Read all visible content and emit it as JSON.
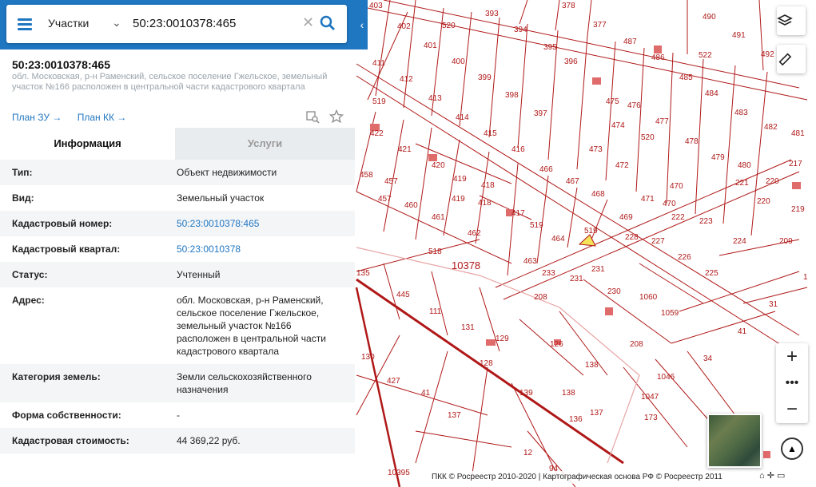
{
  "search": {
    "type_label": "Участки",
    "value": "50:23:0010378:465",
    "clear_symbol": "✕"
  },
  "panel": {
    "title": "50:23:0010378:465",
    "address_sub": "обл. Московская, р-н Раменский, сельское поселение Гжельское, земельный участок №166 расположен в центральной части кадастрового квартала",
    "link_plan_zu": "План ЗУ →",
    "link_plan_kk": "План КК →",
    "tab_info": "Информация",
    "tab_services": "Услуги",
    "rows": [
      {
        "k": "Тип:",
        "v": "Объект недвижимости"
      },
      {
        "k": "Вид:",
        "v": "Земельный участок"
      },
      {
        "k": "Кадастровый номер:",
        "v": "50:23:0010378:465"
      },
      {
        "k": "Кадастровый квартал:",
        "v": "50:23:0010378"
      },
      {
        "k": "Статус:",
        "v": "Учтенный"
      },
      {
        "k": "Адрес:",
        "v": "обл. Московская, р-н Раменский, сельское поселение Гжельское, земельный участок №166 расположен в центральной части кадастрового квартала"
      },
      {
        "k": "Категория земель:",
        "v": "Земли сельскохозяйственного назначения"
      },
      {
        "k": "Форма собственности:",
        "v": "-"
      },
      {
        "k": "Кадастровая стоимость:",
        "v": "44 369,22 руб."
      }
    ]
  },
  "map": {
    "quarter_label": "10378",
    "parcel_labels": [
      "403",
      "402",
      "401",
      "400",
      "399",
      "398",
      "397",
      "396",
      "395",
      "394",
      "393",
      "378",
      "377",
      "487",
      "486",
      "485",
      "484",
      "483",
      "482",
      "481",
      "490",
      "491",
      "492",
      "522",
      "520",
      "519",
      "411",
      "412",
      "413",
      "414",
      "415",
      "416",
      "466",
      "467",
      "468",
      "469",
      "470",
      "471",
      "472",
      "473",
      "474",
      "475",
      "476",
      "477",
      "478",
      "479",
      "480",
      "217",
      "219",
      "220",
      "221",
      "222",
      "223",
      "224",
      "225",
      "226",
      "227",
      "228",
      "209",
      "422",
      "421",
      "420",
      "419",
      "418",
      "417",
      "458",
      "457",
      "460",
      "461",
      "462",
      "463",
      "464",
      "465",
      "518",
      "135",
      "445",
      "111",
      "131",
      "129",
      "128",
      "130",
      "427",
      "41",
      "137",
      "233",
      "231",
      "230",
      "208",
      "1060",
      "1059",
      "31",
      "34",
      "1046",
      "1047",
      "173",
      "126",
      "138",
      "139",
      "136",
      "12",
      "10395",
      "94"
    ],
    "copyright": "ПКК © Росреестр 2010-2020 | Картографическая основа РФ © Росреестр 2011"
  },
  "colors": {
    "accent": "#1f76c1",
    "parcel_line": "#b01818",
    "selected_parcel": "#f5e35a"
  }
}
